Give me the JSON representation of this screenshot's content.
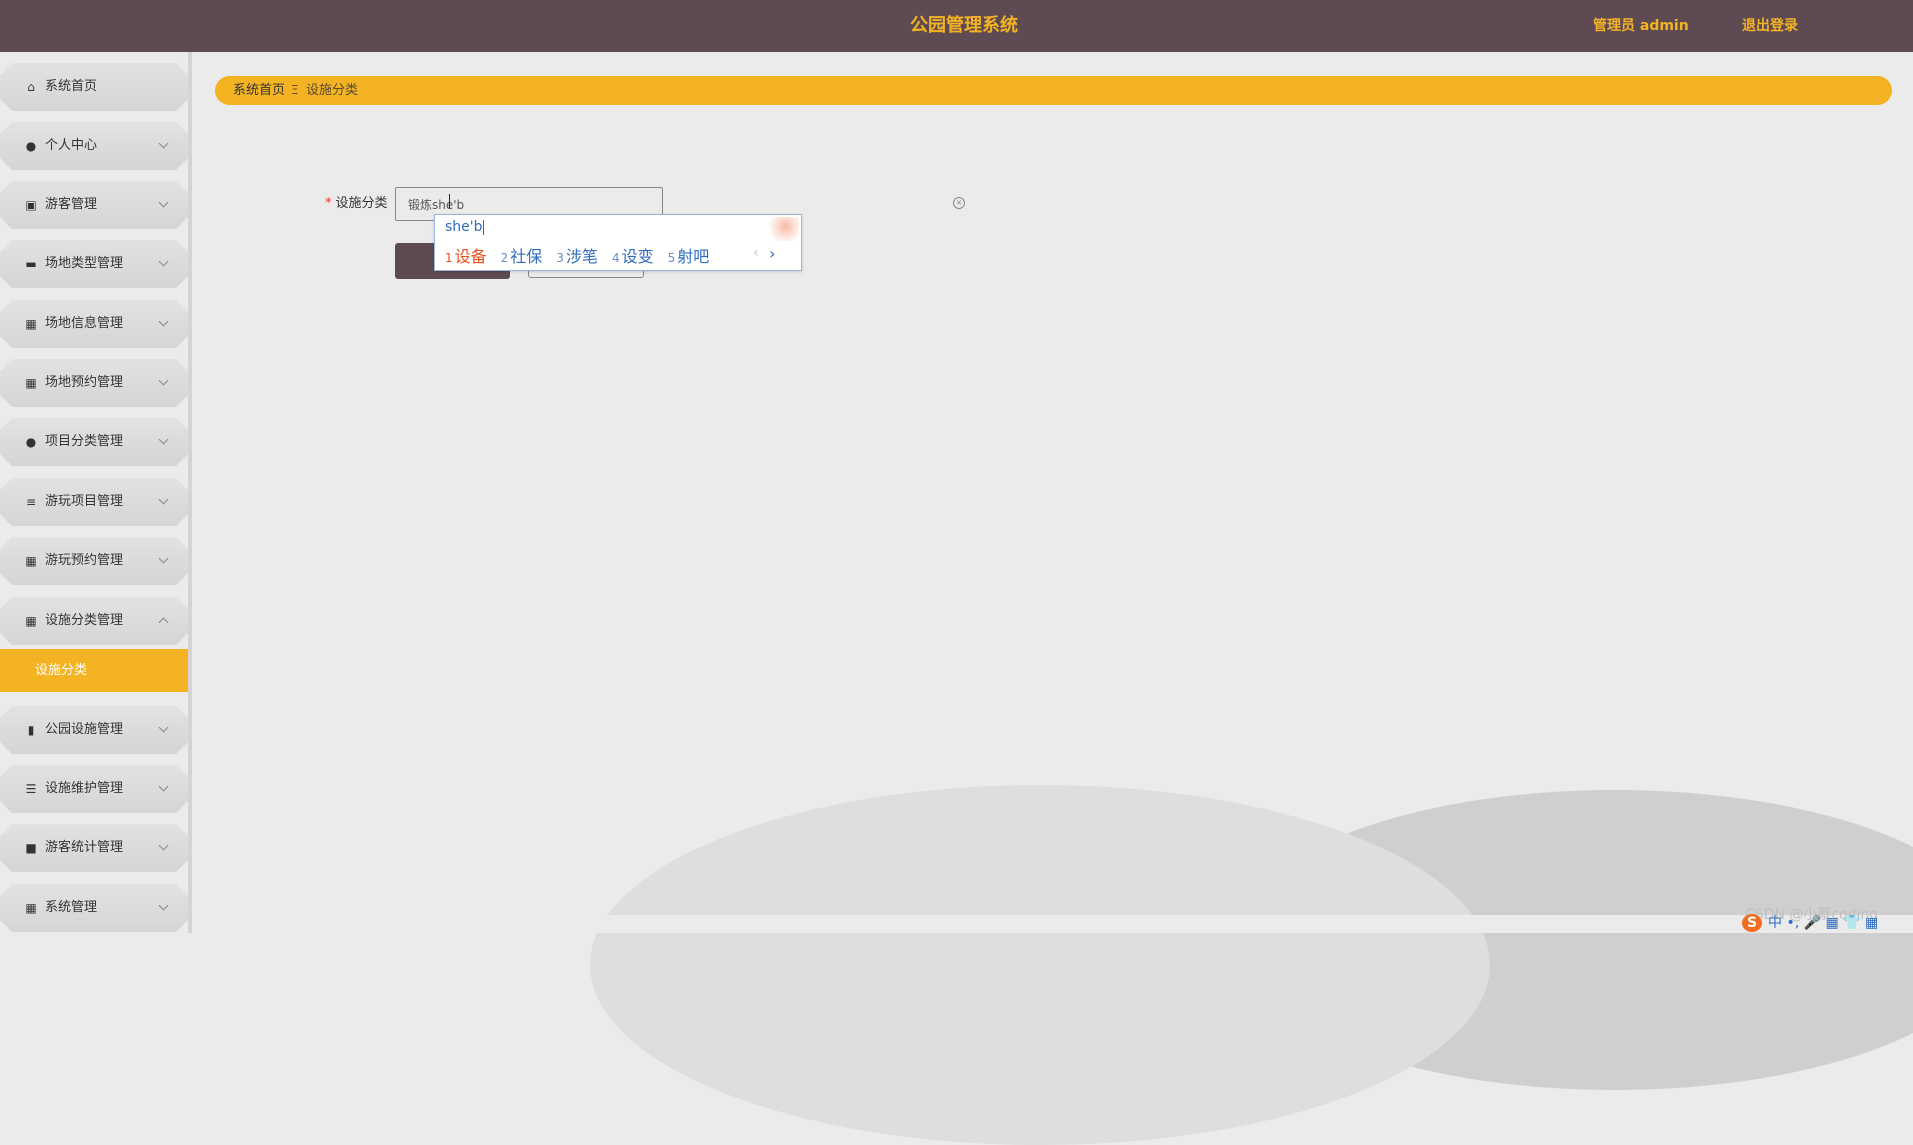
{
  "header": {
    "title": "公园管理系统",
    "admin_label": "管理员 admin",
    "logout_label": "退出登录"
  },
  "sidebar": {
    "items": [
      {
        "label": "系统首页",
        "icon": "home-icon",
        "glyph": "⌂"
      },
      {
        "label": "个人中心",
        "icon": "user-icon",
        "glyph": "●"
      },
      {
        "label": "游客管理",
        "icon": "clipboard-icon",
        "glyph": "▣"
      },
      {
        "label": "场地类型管理",
        "icon": "monitor-icon",
        "glyph": "▬"
      },
      {
        "label": "场地信息管理",
        "icon": "grid-icon",
        "glyph": "▦"
      },
      {
        "label": "场地预约管理",
        "icon": "grid-icon",
        "glyph": "▦"
      },
      {
        "label": "项目分类管理",
        "icon": "user-icon",
        "glyph": "●"
      },
      {
        "label": "游玩项目管理",
        "icon": "list-icon",
        "glyph": "≡"
      },
      {
        "label": "游玩预约管理",
        "icon": "grid-icon",
        "glyph": "▦"
      },
      {
        "label": "设施分类管理",
        "icon": "grid-icon",
        "glyph": "▦"
      },
      {
        "label": "公园设施管理",
        "icon": "bar-chart-icon",
        "glyph": "▮"
      },
      {
        "label": "设施维护管理",
        "icon": "sliders-icon",
        "glyph": "☰"
      },
      {
        "label": "游客统计管理",
        "icon": "briefcase-icon",
        "glyph": "■"
      },
      {
        "label": "系统管理",
        "icon": "grid-icon",
        "glyph": "▦"
      }
    ],
    "active_sub": "设施分类"
  },
  "breadcrumb": {
    "home": "系统首页",
    "separator": "Ξ",
    "current": "设施分类"
  },
  "form": {
    "field_label": "设施分类",
    "required_mark": "*",
    "field_value": "锻炼she'b",
    "clear_glyph": "×"
  },
  "ime": {
    "pinyin": "she'b",
    "candidates": [
      {
        "n": "1",
        "text": "设备"
      },
      {
        "n": "2",
        "text": "社保"
      },
      {
        "n": "3",
        "text": "涉笔"
      },
      {
        "n": "4",
        "text": "设变"
      },
      {
        "n": "5",
        "text": "射吧"
      }
    ],
    "prev": "‹",
    "next": "›"
  },
  "footer": {
    "watermark": "CSDN @小蔡coding",
    "ime_bar_logo": "S",
    "ime_bar_text": "中 •, 🎤 ▦ 👕 ▦"
  },
  "colors": {
    "header_bg": "#5e4a52",
    "accent": "#f4b323",
    "page_bg": "#ebebeb"
  }
}
